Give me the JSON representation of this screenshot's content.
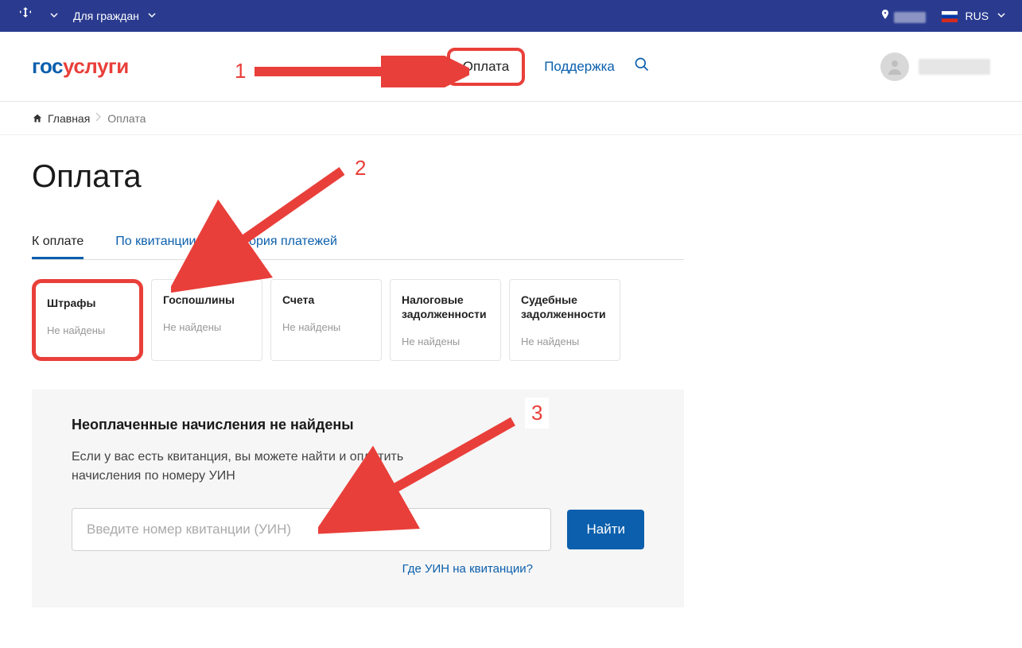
{
  "topbar": {
    "citizens_label": "Для граждан",
    "lang_label": "RUS"
  },
  "logo": {
    "part1": "гос",
    "part2": "услуги"
  },
  "nav": {
    "payment": "Оплата",
    "support": "Поддержка"
  },
  "breadcrumbs": {
    "home": "Главная",
    "current": "Оплата"
  },
  "page_title": "Оплата",
  "tabs": [
    {
      "label": "К оплате",
      "active": true
    },
    {
      "label": "По квитанции",
      "active": false
    },
    {
      "label": "История платежей",
      "active": false
    }
  ],
  "cards": [
    {
      "title": "Штрафы",
      "status": "Не найдены"
    },
    {
      "title": "Госпошлины",
      "status": "Не найдены"
    },
    {
      "title": "Счета",
      "status": "Не найдены"
    },
    {
      "title": "Налоговые задолженности",
      "status": "Не найдены"
    },
    {
      "title": "Судебные задолженности",
      "status": "Не найдены"
    }
  ],
  "panel": {
    "heading": "Неоплаченные начисления не найдены",
    "text": "Если у вас есть квитанция, вы можете найти и оплатить начисления по номеру УИН",
    "placeholder": "Введите номер квитанции (УИН)",
    "button": "Найти",
    "help": "Где УИН на квитанции?"
  },
  "annotations": {
    "n1": "1",
    "n2": "2",
    "n3": "3"
  }
}
